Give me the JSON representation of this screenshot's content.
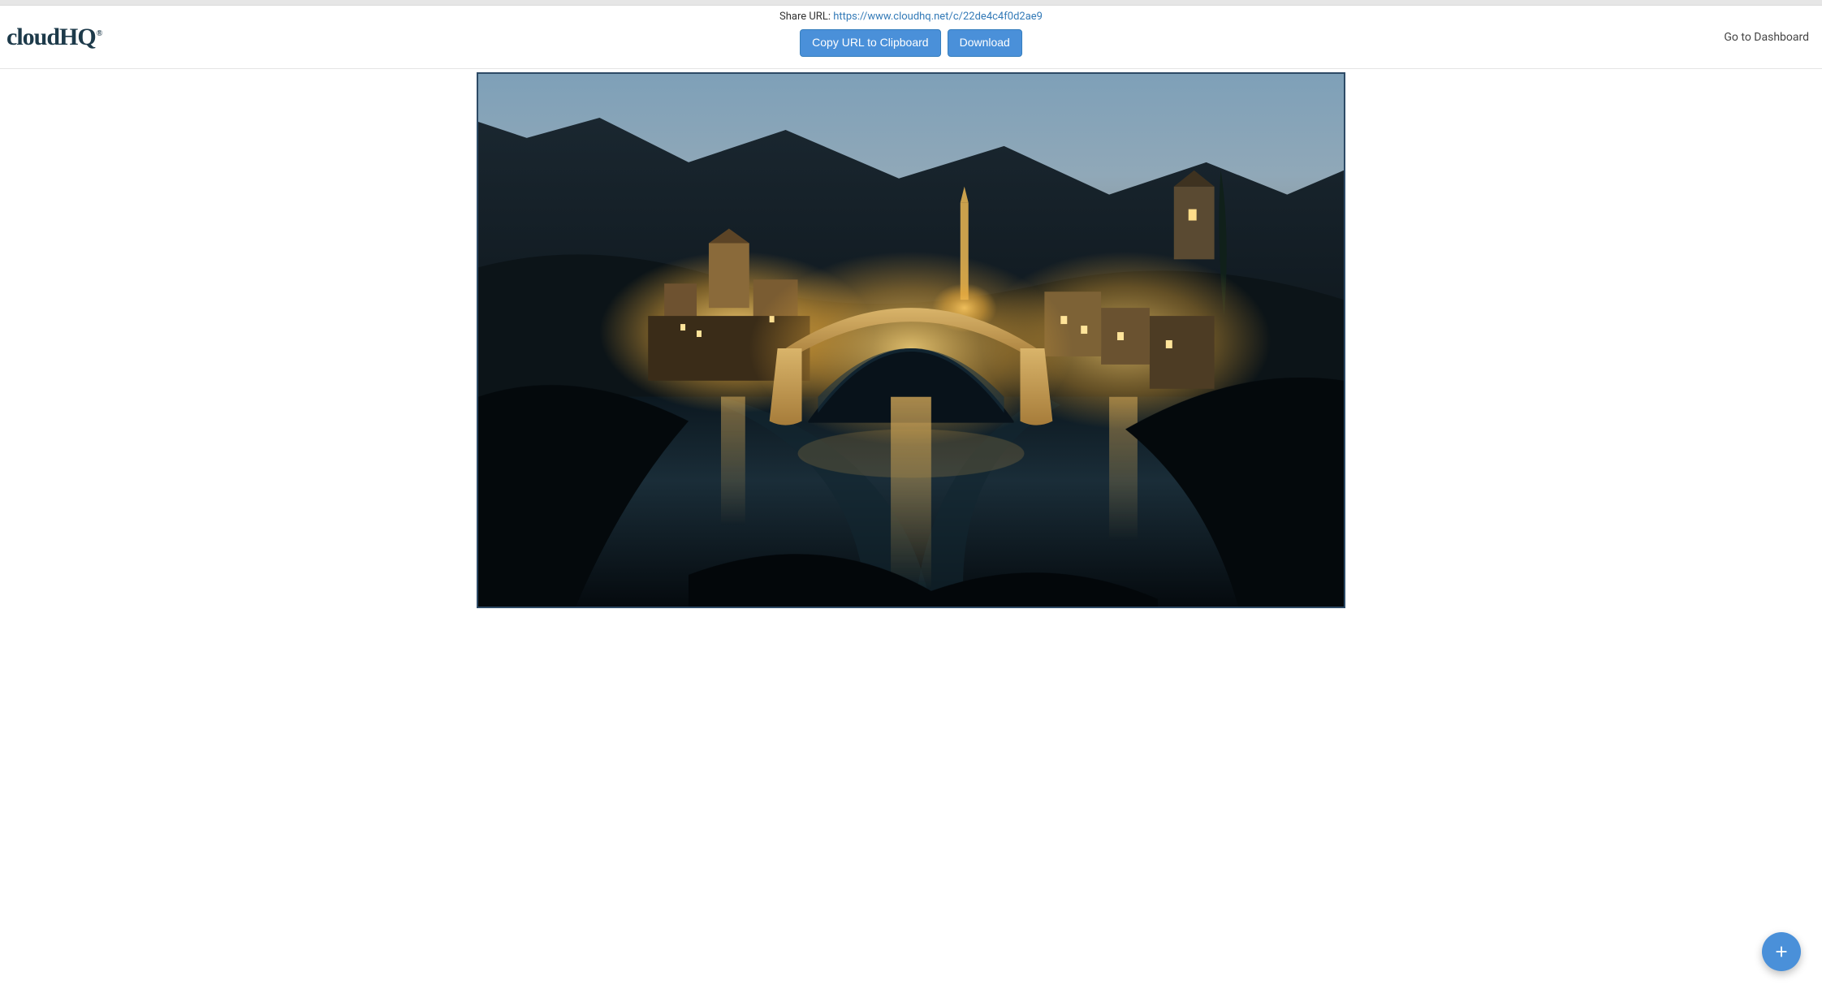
{
  "logo_text": "cloudHQ",
  "logo_reg": "®",
  "share_label": "Share URL: ",
  "share_url": "https://www.cloudhq.net/c/22de4c4f0d2ae9",
  "buttons": {
    "copy": "Copy URL to Clipboard",
    "download": "Download"
  },
  "dashboard_link": "Go to Dashboard",
  "fab_icon": "plus-icon",
  "image_alt": "Shared image (illuminated arched stone bridge over river at dusk with old town buildings and mountains behind)"
}
